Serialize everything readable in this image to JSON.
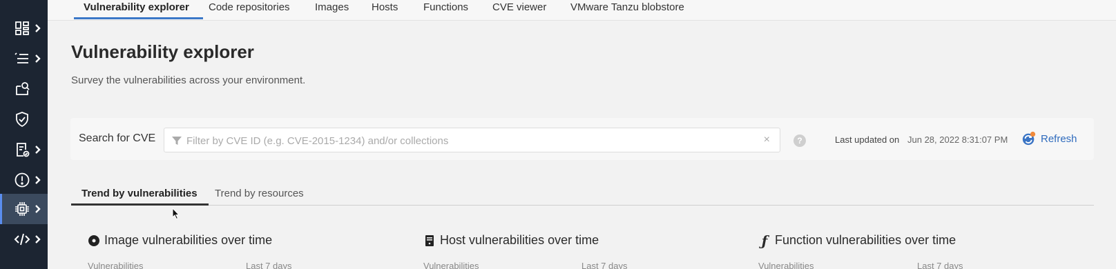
{
  "sidebar": {
    "items": [
      {
        "icon": "dashboard-icon",
        "has_chevron": true
      },
      {
        "icon": "list-check-icon",
        "has_chevron": true
      },
      {
        "icon": "scan-document-icon",
        "has_chevron": false
      },
      {
        "icon": "shield-check-icon",
        "has_chevron": false
      },
      {
        "icon": "compliance-report-icon",
        "has_chevron": true
      },
      {
        "icon": "alert-icon",
        "has_chevron": true
      },
      {
        "icon": "chip-icon",
        "has_chevron": true,
        "active": true
      },
      {
        "icon": "code-icon",
        "has_chevron": true
      }
    ]
  },
  "topnav": {
    "tabs": [
      {
        "label": "Vulnerability explorer",
        "active": true
      },
      {
        "label": "Code repositories"
      },
      {
        "label": "Images"
      },
      {
        "label": "Hosts"
      },
      {
        "label": "Functions"
      },
      {
        "label": "CVE viewer"
      },
      {
        "label": "VMware Tanzu blobstore"
      }
    ]
  },
  "page": {
    "title": "Vulnerability explorer",
    "subtitle": "Survey the vulnerabilities across your environment."
  },
  "search": {
    "label": "Search for CVE",
    "placeholder": "Filter by CVE ID (e.g. CVE-2015-1234) and/or collections",
    "value": "",
    "help": "?",
    "clear": "×",
    "last_updated_label": "Last updated on",
    "last_updated_value": "Jun 28, 2022 8:31:07 PM",
    "refresh_label": "Refresh"
  },
  "subtabs": [
    {
      "label": "Trend by vulnerabilities",
      "active": true
    },
    {
      "label": "Trend by resources"
    }
  ],
  "cards": [
    {
      "title": "Image vulnerabilities over time",
      "icon": "image-circle-icon",
      "sub_left": "Vulnerabilities",
      "sub_right": "Last 7 days"
    },
    {
      "title": "Host vulnerabilities over time",
      "icon": "host-server-icon",
      "sub_left": "Vulnerabilities",
      "sub_right": "Last 7 days"
    },
    {
      "title": "Function vulnerabilities over time",
      "icon": "function-icon",
      "sub_left": "Vulnerabilities",
      "sub_right": "Last 7 days"
    }
  ],
  "colors": {
    "sidebar_bg": "#1c2532",
    "accent": "#3b78c8",
    "refresh": "#2f6bbd"
  }
}
